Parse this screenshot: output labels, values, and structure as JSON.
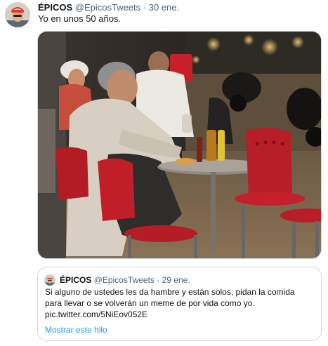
{
  "tweet": {
    "display_name": "ÉPICOS",
    "handle": "@EpicosTweets",
    "separator": "·",
    "date": "30 ene.",
    "text": "Yo en unos 50 años."
  },
  "photo": {
    "icon": "photo-old-man-at-street-cafe"
  },
  "quoted": {
    "display_name": "ÉPICOS",
    "handle": "@EpicosTweets",
    "separator": "·",
    "date": "29 ene.",
    "lines": [
      "Si alguno de ustedes les da hambre y están solos, pidan la comida",
      "para llevar o se volverán un meme de por vida como yo.",
      "pic.twitter.com/5NiEov052E"
    ],
    "show_thread": "Mostrar este hilo"
  },
  "colors": {
    "text": "#0f1419",
    "secondary": "#536471",
    "link": "#1d9bf0",
    "border": "#cfd9de"
  }
}
